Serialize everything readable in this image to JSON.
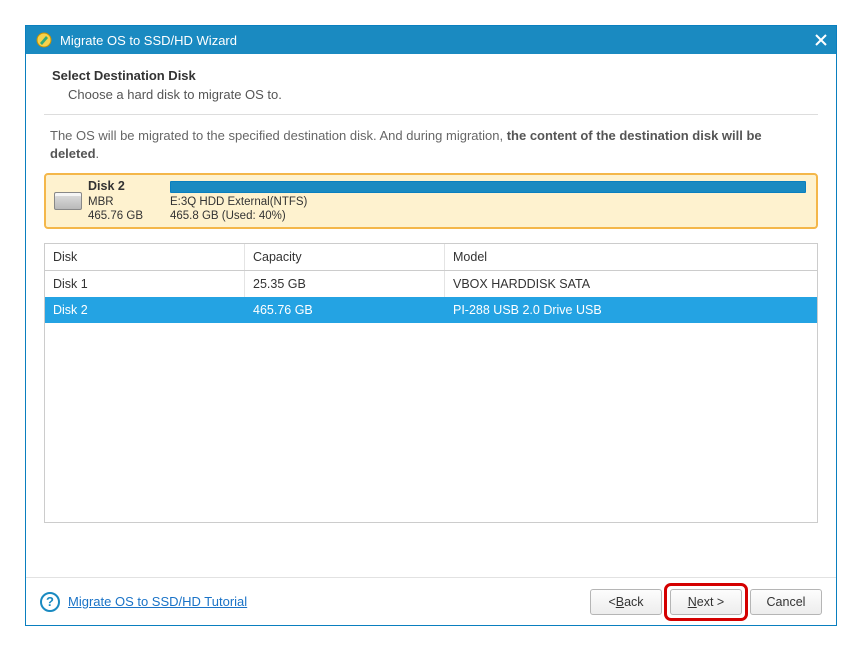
{
  "window": {
    "title": "Migrate OS to SSD/HD Wizard"
  },
  "header": {
    "heading": "Select Destination Disk",
    "subtext": "Choose a hard disk to migrate OS to."
  },
  "notice": {
    "prefix": "The OS will be migrated to the specified destination disk. And during migration, ",
    "bold": "the content of the destination disk will be deleted",
    "suffix": "."
  },
  "preview": {
    "disk_name": "Disk 2",
    "scheme": "MBR",
    "size": "465.76 GB",
    "partition_label": "E:3Q HDD External(NTFS)",
    "partition_usage": "465.8 GB (Used: 40%)"
  },
  "table": {
    "headers": {
      "disk": "Disk",
      "capacity": "Capacity",
      "model": "Model"
    },
    "rows": [
      {
        "disk": "Disk 1",
        "capacity": "25.35 GB",
        "model": "VBOX HARDDISK SATA",
        "selected": false
      },
      {
        "disk": "Disk 2",
        "capacity": "465.76 GB",
        "model": "PI-288 USB 2.0 Drive USB",
        "selected": true
      }
    ]
  },
  "footer": {
    "tutorial_link": "Migrate OS to SSD/HD Tutorial",
    "back_prefix": "< ",
    "back_u": "B",
    "back_rest": "ack",
    "next_u": "N",
    "next_rest": "ext >",
    "cancel": "Cancel"
  }
}
